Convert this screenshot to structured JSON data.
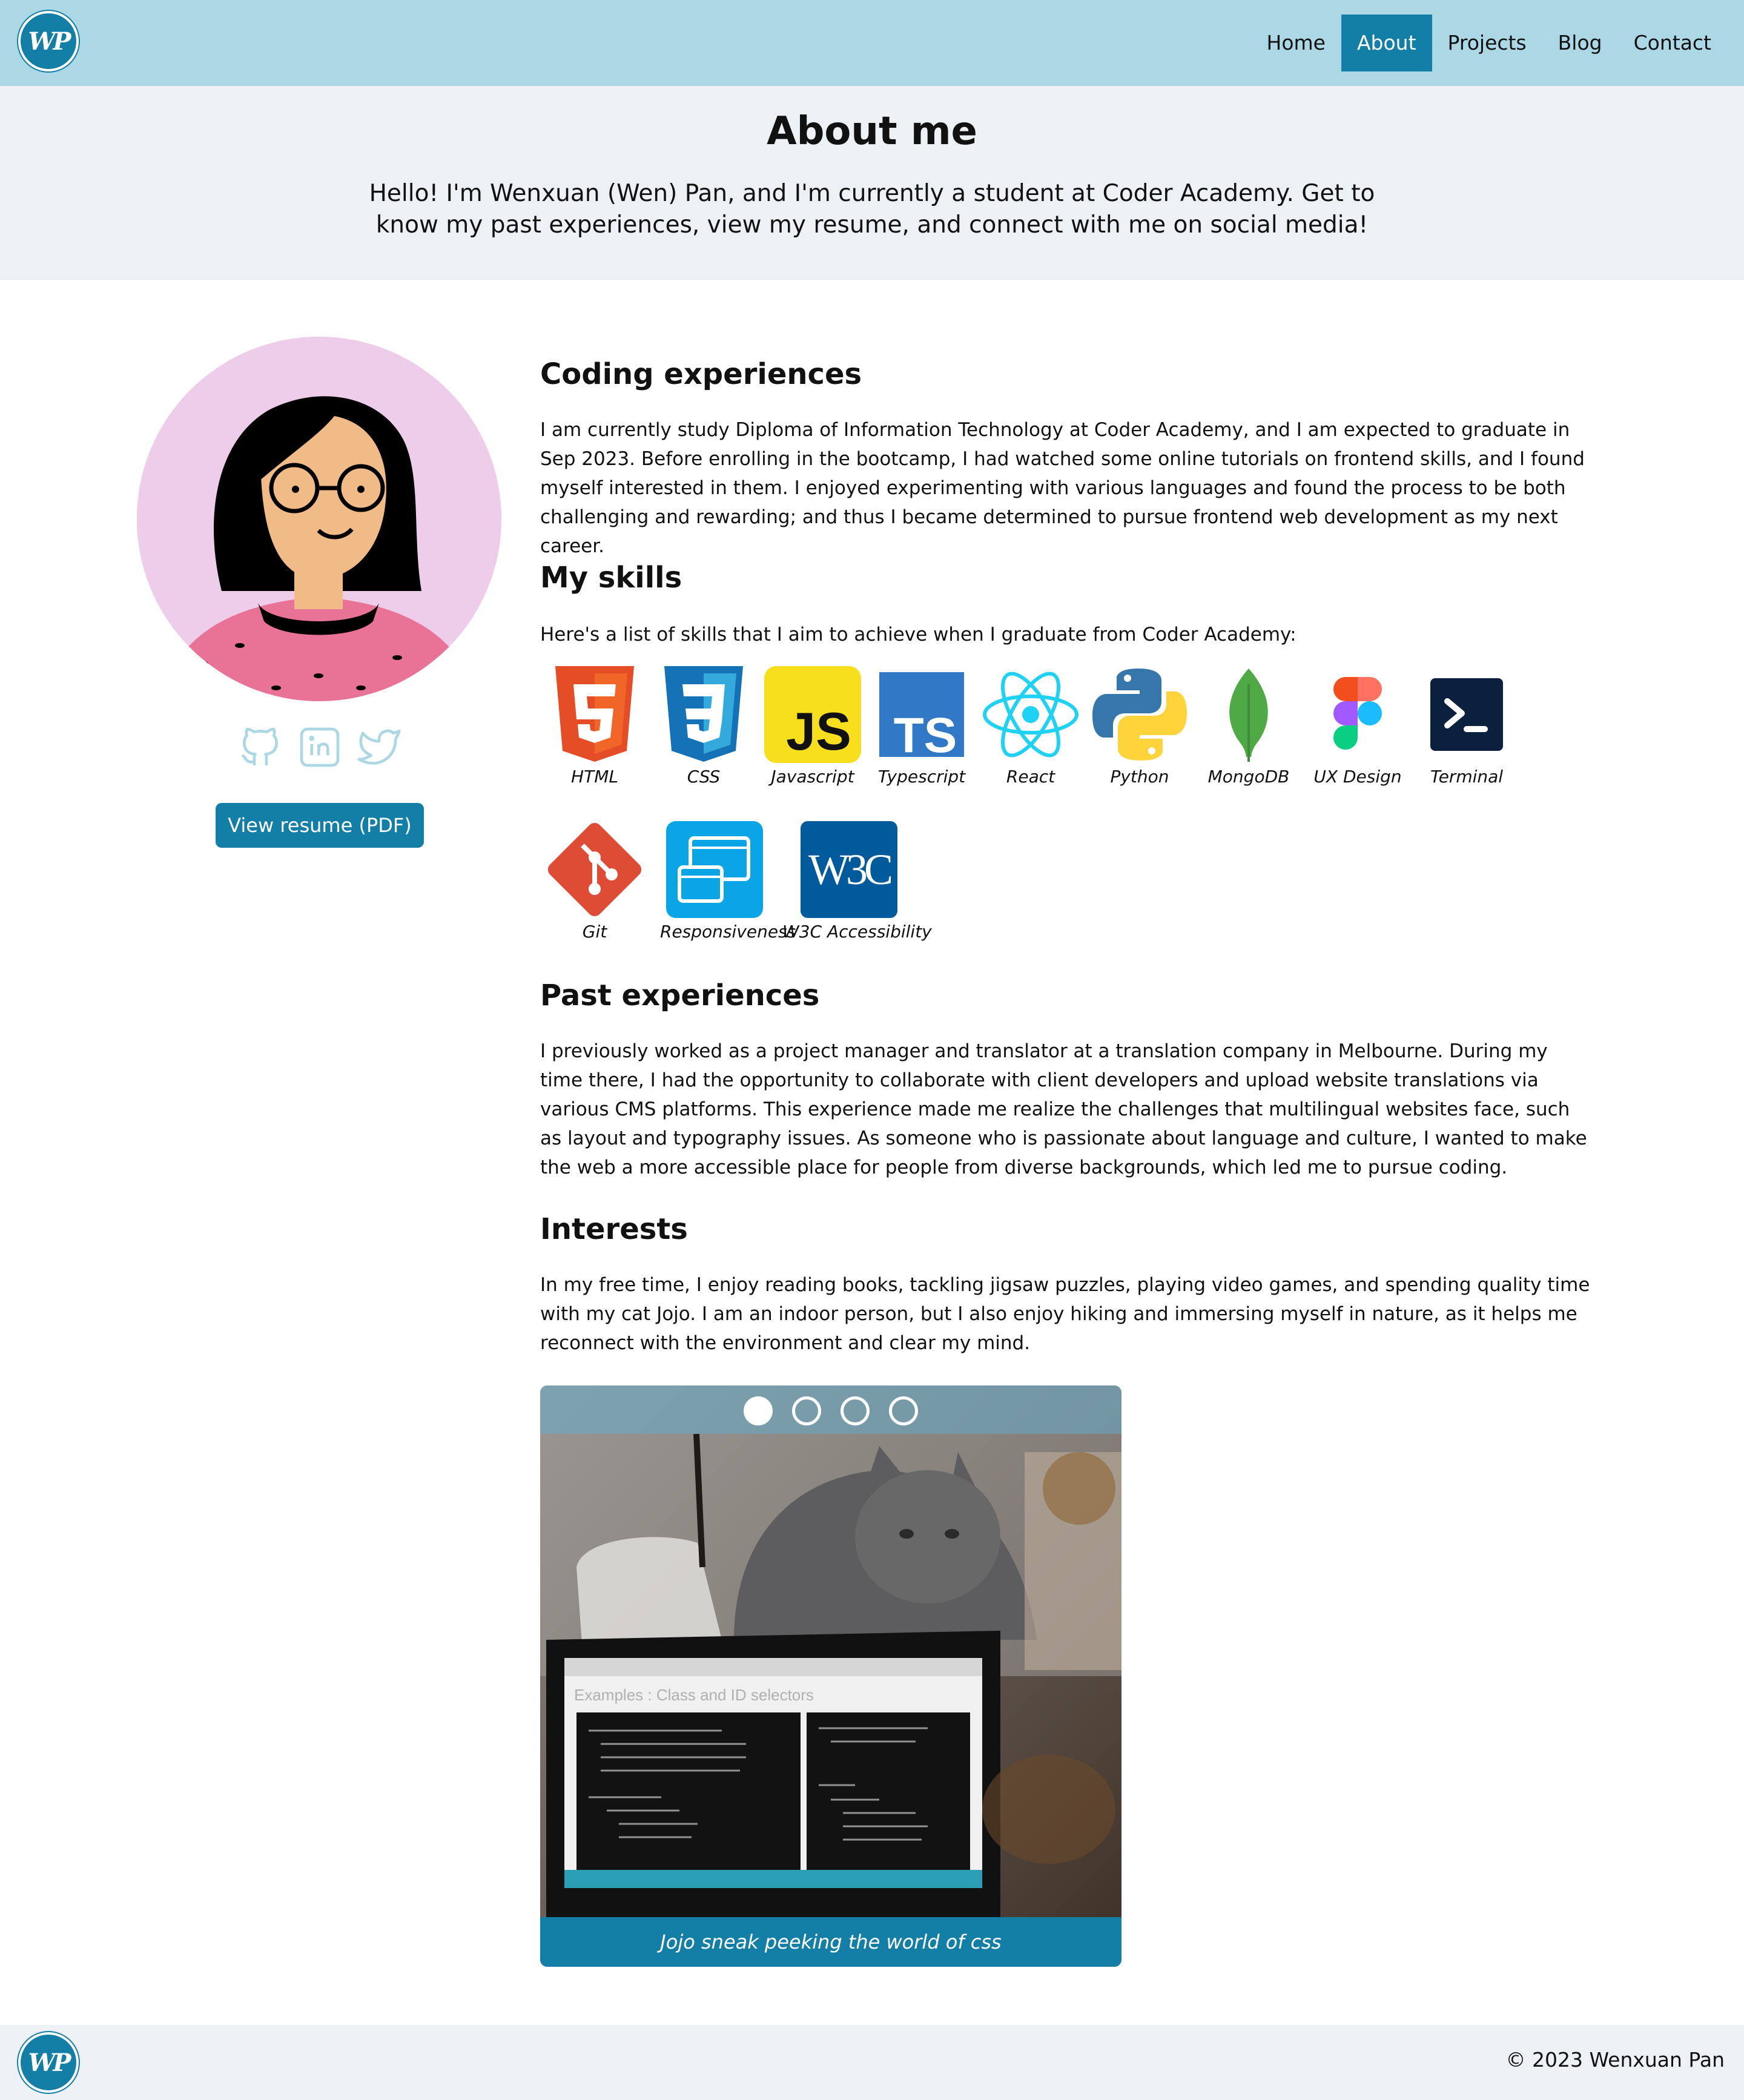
{
  "header": {
    "logo_text": "WP",
    "nav": [
      {
        "label": "Home",
        "active": false
      },
      {
        "label": "About",
        "active": true
      },
      {
        "label": "Projects",
        "active": false
      },
      {
        "label": "Blog",
        "active": false
      },
      {
        "label": "Contact",
        "active": false
      }
    ]
  },
  "hero": {
    "title": "About me",
    "intro": "Hello! I'm Wenxuan (Wen) Pan, and I'm currently a student at Coder Academy. Get to know my past experiences, view my resume, and connect with me on social media!"
  },
  "sidebar": {
    "socials": [
      "github-icon",
      "linkedin-icon",
      "twitter-icon"
    ],
    "resume_button": "View resume (PDF)"
  },
  "sections": {
    "coding": {
      "title": "Coding experiences",
      "text": "I am currently study Diploma of Information Technology at Coder Academy, and I am expected to graduate in Sep 2023. Before enrolling in the bootcamp, I had watched some online tutorials on frontend skills, and I found myself interested in them. I enjoyed experimenting with various languages and found the process to be both challenging and rewarding; and thus I became determined to pursue frontend web development as my next career."
    },
    "skills": {
      "title": "My skills",
      "text": "Here's a list of skills that I aim to achieve when I graduate from Coder Academy:",
      "items": [
        "HTML",
        "CSS",
        "Javascript",
        "Typescript",
        "React",
        "Python",
        "MongoDB",
        "UX Design",
        "Terminal",
        "Git",
        "Responsiveness",
        "W3C Accessibility"
      ],
      "icon_text": {
        "js": "JS",
        "ts": "TS",
        "w3c": "W3C"
      }
    },
    "past": {
      "title": "Past experiences",
      "text": "I previously worked as a project manager and translator at a translation company in Melbourne. During my time there, I had the opportunity to collaborate with client developers and upload website translations via various CMS platforms. This experience made me realize the challenges that multilingual websites face, such as layout and typography issues. As someone who is passionate about language and culture, I wanted to make the web a more accessible place for people from diverse backgrounds, which led me to pursue coding."
    },
    "interests": {
      "title": "Interests",
      "text": "In my free time, I enjoy reading books, tackling jigsaw puzzles, playing video games, and spending quality time with my cat Jojo. I am an indoor person, but I also enjoy hiking and immersing myself in nature, as it helps me reconnect with the environment and clear my mind."
    }
  },
  "carousel": {
    "slides": 4,
    "active_slide": 1,
    "caption": "Jojo sneak peeking the world of css",
    "screen_heading": "Examples : Class and ID selectors"
  },
  "footer": {
    "copyright": "© 2023 Wenxuan Pan"
  },
  "colors": {
    "header_bg": "#acd8e6",
    "accent": "#137ea6",
    "hero_bg": "#edf0f5"
  }
}
